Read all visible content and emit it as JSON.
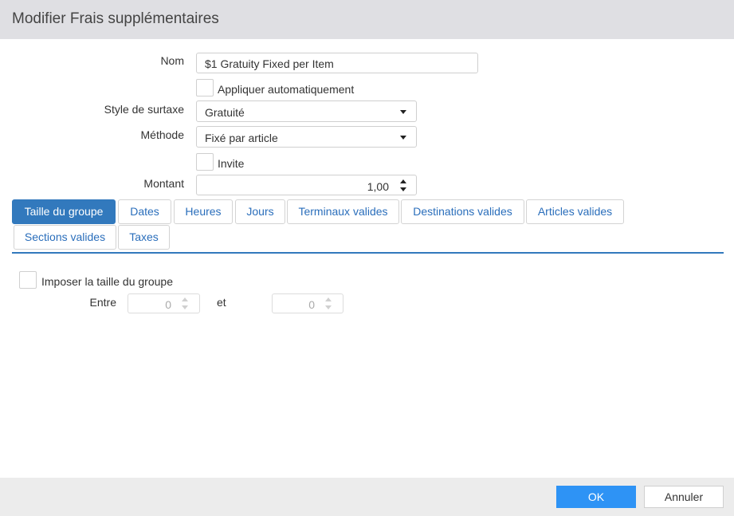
{
  "dialog": {
    "title": "Modifier Frais supplémentaires"
  },
  "form": {
    "nom_label": "Nom",
    "nom_value": "$1 Gratuity Fixed per Item",
    "auto_apply_label": "Appliquer automatiquement",
    "auto_apply_checked": false,
    "style_label": "Style de surtaxe",
    "style_value": "Gratuité",
    "methode_label": "Méthode",
    "methode_value": "Fixé par article",
    "invite_label": "Invite",
    "invite_checked": false,
    "montant_label": "Montant",
    "montant_value": "1,00"
  },
  "tabs": [
    {
      "label": "Taille du groupe",
      "active": true
    },
    {
      "label": "Dates"
    },
    {
      "label": "Heures"
    },
    {
      "label": "Jours"
    },
    {
      "label": "Terminaux valides"
    },
    {
      "label": "Destinations valides"
    },
    {
      "label": "Articles valides"
    },
    {
      "label": "Sections valides"
    },
    {
      "label": "Taxes"
    }
  ],
  "group": {
    "enforce_label": "Imposer la taille du groupe",
    "enforce_checked": false,
    "between_label": "Entre",
    "min_value": "0",
    "and_label": "et",
    "max_value": "0"
  },
  "footer": {
    "ok_label": "OK",
    "cancel_label": "Annuler"
  },
  "colors": {
    "accent": "#3279bd",
    "ok_button": "#2e93f5",
    "titlebar": "#dfdfe3"
  }
}
